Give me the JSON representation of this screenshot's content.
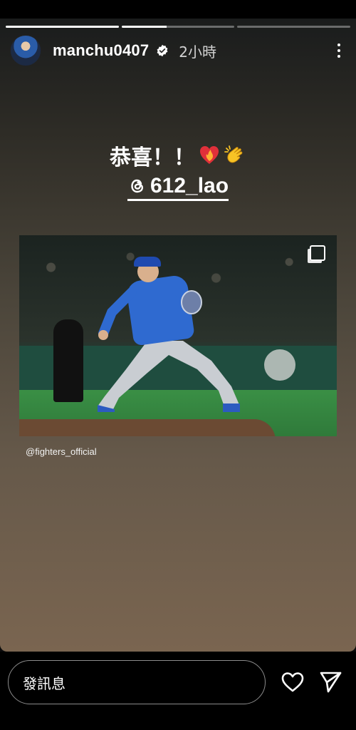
{
  "story": {
    "username": "manchu0407",
    "time_ago": "2小時",
    "caption": "恭喜！！",
    "mention": "612_lao",
    "photo_credit": "@fighters_official",
    "progress_segments": [
      {
        "state": "done"
      },
      {
        "state": "current"
      },
      {
        "state": "pending"
      }
    ]
  },
  "reply": {
    "placeholder": "發訊息"
  },
  "icons": {
    "verified": "verified-badge-icon",
    "more": "more-vertical-icon",
    "heart_emoji": "heart-on-fire-emoji",
    "clap_emoji": "clapping-hands-emoji",
    "threads": "threads-icon",
    "multi_photo": "multi-photo-icon",
    "like": "heart-icon",
    "send": "send-icon"
  },
  "colors": {
    "bar_background": "#000000",
    "text": "#ffffff",
    "story_gradient_top": "#1a1c1c",
    "story_gradient_bottom": "#7a6550"
  }
}
